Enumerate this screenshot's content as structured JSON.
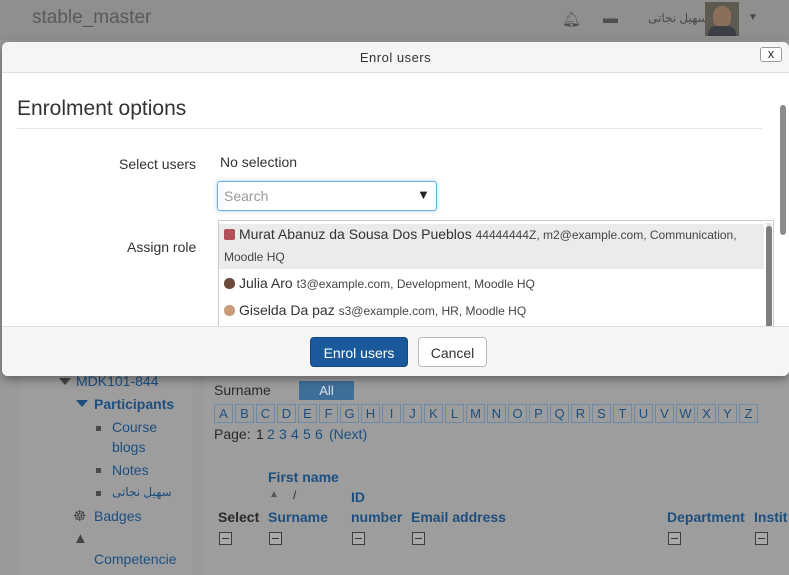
{
  "navbar": {
    "site_name": "stable_master",
    "user_name": "سهیل نجاتی"
  },
  "background": {
    "nav": {
      "course": "MDK101-844",
      "participants": "Participants",
      "course_blogs_1": "Course",
      "course_blogs_2": "blogs",
      "notes": "Notes",
      "user": "سهیل نجاتی",
      "badges": "Badges",
      "competencies": "Competencie"
    },
    "filter": {
      "surname_label": "Surname",
      "all": "All",
      "letters": [
        "A",
        "B",
        "C",
        "D",
        "E",
        "F",
        "G",
        "H",
        "I",
        "J",
        "K",
        "L",
        "M",
        "N",
        "O",
        "P",
        "Q",
        "R",
        "S",
        "T",
        "U",
        "V",
        "W",
        "X",
        "Y",
        "Z"
      ],
      "page_label": "Page:",
      "pages": [
        "1",
        "2",
        "3",
        "4",
        "5",
        "6"
      ],
      "next": "(Next)"
    },
    "table_headers": {
      "select": "Select",
      "first_name": "First name",
      "slash": "/",
      "surname": "Surname",
      "id_1": "ID",
      "id_2": "number",
      "email": "Email address",
      "department": "Department",
      "institution": "Instit"
    }
  },
  "modal": {
    "title": "Enrol users",
    "close_label": "x",
    "legend": "Enrolment options",
    "select_users_label": "Select users",
    "no_selection": "No selection",
    "search_placeholder": "Search",
    "assign_role_label": "Assign role",
    "suggestions": [
      {
        "name": "Murat Abanuz da Sousa Dos Pueblos",
        "meta_1": "44444444Z, m2@example.com, Communication,",
        "meta_2": "Moodle HQ",
        "icon_color": "#b0505a"
      },
      {
        "name": "Julia Aro",
        "meta_1": "t3@example.com, Development, Moodle HQ",
        "icon_color": "#6a4a3a"
      },
      {
        "name": "Giselda Da paz",
        "meta_1": "s3@example.com, HR, Moodle HQ",
        "icon_color": "#c99b7a"
      }
    ],
    "enrol_button": "Enrol users",
    "cancel_button": "Cancel"
  }
}
